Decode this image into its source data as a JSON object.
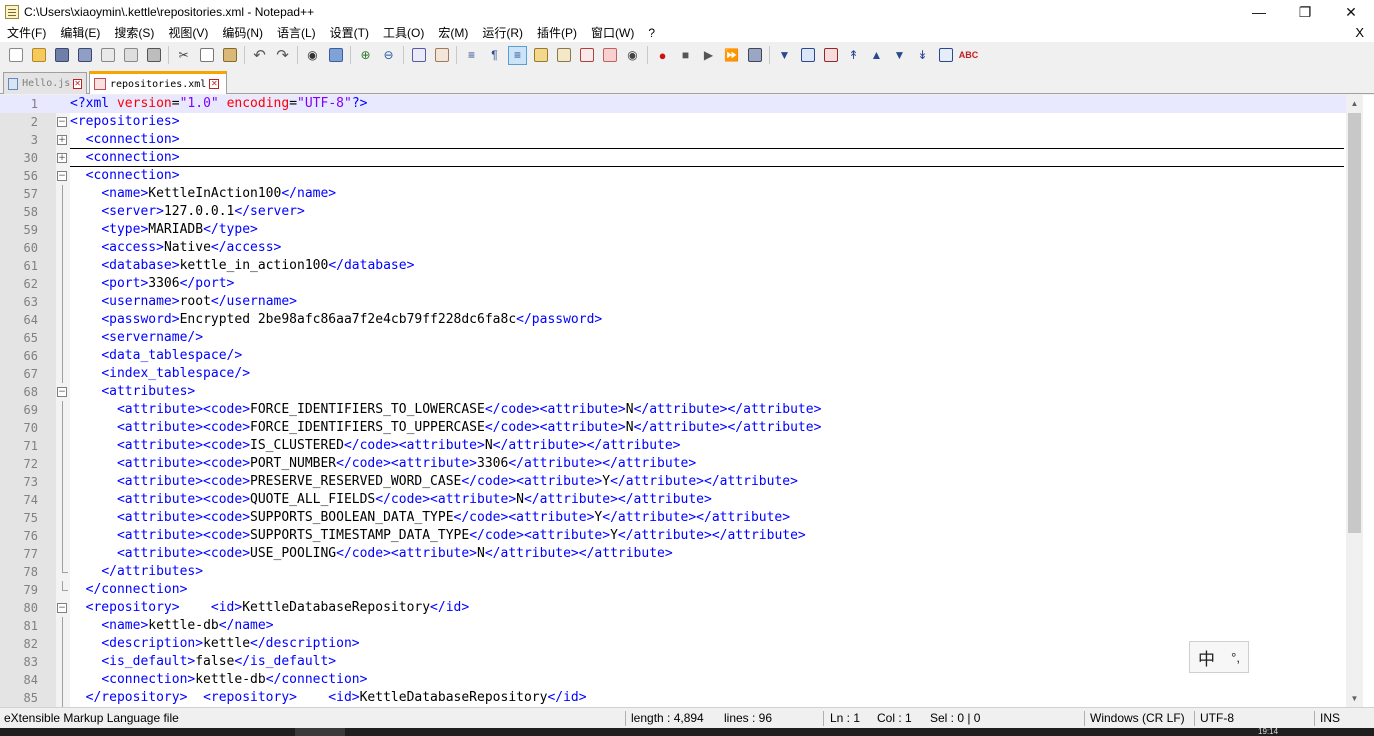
{
  "window": {
    "title": "C:\\Users\\xiaoymin\\.kettle\\repositories.xml - Notepad++",
    "app_icon": "notepad-icon",
    "buttons": [
      "minimize",
      "restore",
      "close"
    ]
  },
  "menu": {
    "items": [
      "文件(F)",
      "编辑(E)",
      "搜索(S)",
      "视图(V)",
      "编码(N)",
      "语言(L)",
      "设置(T)",
      "工具(O)",
      "宏(M)",
      "运行(R)",
      "插件(P)",
      "窗口(W)",
      "?"
    ],
    "close": "X"
  },
  "toolbar": {
    "icons": [
      "new-file-icon",
      "open-file-icon",
      "save-icon",
      "save-all-icon",
      "close-icon",
      "close-all-icon",
      "print-icon",
      "cut-icon",
      "copy-icon",
      "paste-icon",
      "undo-icon",
      "redo-icon",
      "find-icon",
      "replace-icon",
      "zoom-in-icon",
      "zoom-out-icon",
      "sync-vertical-icon",
      "sync-horizontal-icon",
      "word-wrap-icon",
      "show-all-chars-icon",
      "indent-guide-icon",
      "user-lang-icon",
      "doc-map-icon",
      "function-list-icon",
      "folder-workspace-icon",
      "monitor-icon",
      "record-macro-icon",
      "stop-record-icon",
      "play-macro-icon",
      "run-macro-multiple-icon",
      "save-macro-icon",
      "spell-check-icon"
    ],
    "colors": {
      "accent": "#f8a500",
      "keyword": "#0000ff"
    }
  },
  "tabs": [
    {
      "label": "Hello.js",
      "active": false
    },
    {
      "label": "repositories.xml",
      "active": true
    }
  ],
  "editor": {
    "lines": [
      {
        "n": "1"
      },
      {
        "n": "2"
      },
      {
        "n": "3"
      },
      {
        "n": "30"
      },
      {
        "n": "56"
      },
      {
        "n": "57"
      },
      {
        "n": "58"
      },
      {
        "n": "59"
      },
      {
        "n": "60"
      },
      {
        "n": "61"
      },
      {
        "n": "62"
      },
      {
        "n": "63"
      },
      {
        "n": "64"
      },
      {
        "n": "65"
      },
      {
        "n": "66"
      },
      {
        "n": "67"
      },
      {
        "n": "68"
      },
      {
        "n": "69"
      },
      {
        "n": "70"
      },
      {
        "n": "71"
      },
      {
        "n": "72"
      },
      {
        "n": "73"
      },
      {
        "n": "74"
      },
      {
        "n": "75"
      },
      {
        "n": "76"
      },
      {
        "n": "77"
      },
      {
        "n": "78"
      },
      {
        "n": "79"
      },
      {
        "n": "80"
      },
      {
        "n": "81"
      },
      {
        "n": "82"
      },
      {
        "n": "83"
      },
      {
        "n": "84"
      },
      {
        "n": "85"
      }
    ],
    "values": {
      "xml_decl_version": "\"1.0\"",
      "xml_decl_encoding": "\"UTF-8\"",
      "name": "KettleInAction100",
      "server": "127.0.0.1",
      "type": "MARIADB",
      "access": "Native",
      "database": "kettle_in_action100",
      "port": "3306",
      "username": "root",
      "password": "Encrypted 2be98afc86aa7f2e4cb79ff228dc6fa8c",
      "attr_codes": [
        "FORCE_IDENTIFIERS_TO_LOWERCASE",
        "FORCE_IDENTIFIERS_TO_UPPERCASE",
        "IS_CLUSTERED",
        "PORT_NUMBER",
        "PRESERVE_RESERVED_WORD_CASE",
        "QUOTE_ALL_FIELDS",
        "SUPPORTS_BOOLEAN_DATA_TYPE",
        "SUPPORTS_TIMESTAMP_DATA_TYPE",
        "USE_POOLING"
      ],
      "attr_values": [
        "N",
        "N",
        "N",
        "3306",
        "Y",
        "N",
        "Y",
        "Y",
        "N"
      ],
      "repo_id": "KettleDatabaseRepository",
      "repo_name": "kettle-db",
      "repo_description": "kettle",
      "repo_is_default": "false",
      "repo_connection": "kettle-db"
    }
  },
  "ime": {
    "lang": "中",
    "punct": "°,"
  },
  "status": {
    "filetype": "eXtensible Markup Language file",
    "length": "length : 4,894",
    "lines": "lines : 96",
    "ln": "Ln : 1",
    "col": "Col : 1",
    "sel": "Sel : 0 | 0",
    "eol": "Windows (CR LF)",
    "encoding": "UTF-8",
    "mode": "INS"
  },
  "taskbar": {
    "clock": "19:14"
  }
}
